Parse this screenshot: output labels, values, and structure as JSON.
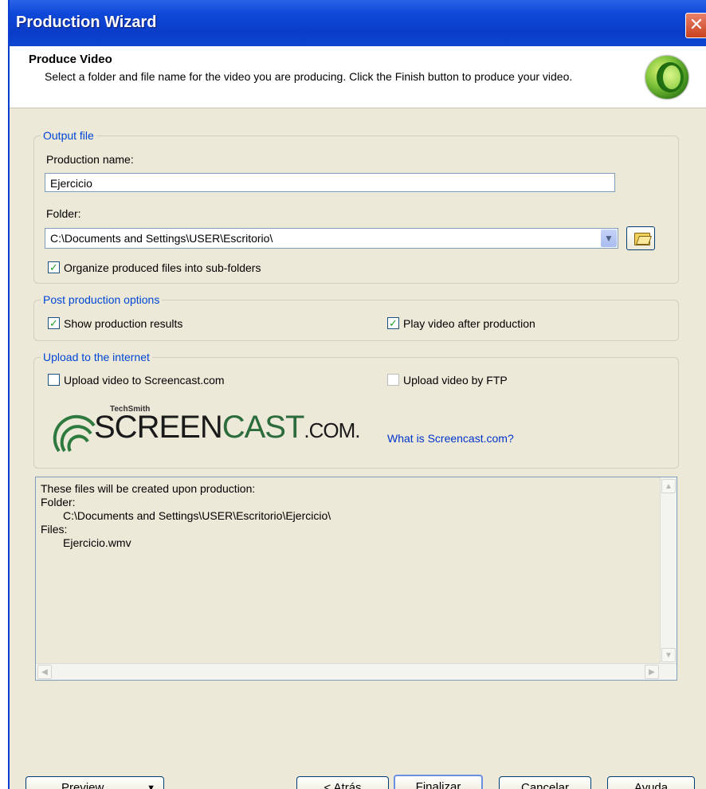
{
  "window": {
    "title": "Production Wizard",
    "close_glyph": "✕"
  },
  "header": {
    "title": "Produce Video",
    "description": "Select a folder and file name for the video you are producing.  Click the Finish button to produce your video."
  },
  "output_file": {
    "legend": "Output file",
    "production_name_label": "Production name:",
    "production_name_value": "Ejercicio",
    "folder_label": "Folder:",
    "folder_value": "C:\\Documents and Settings\\USER\\Escritorio\\",
    "organize_label": "Organize produced files into sub-folders",
    "organize_checked": true
  },
  "post_production": {
    "legend": "Post production options",
    "show_results_label": "Show production results",
    "show_results_checked": true,
    "play_video_label": "Play video after production",
    "play_video_checked": true
  },
  "upload": {
    "legend": "Upload to the internet",
    "screencast_label": "Upload video to Screencast.com",
    "screencast_checked": false,
    "ftp_label": "Upload video by FTP",
    "ftp_checked": false,
    "logo_techsmith": "TechSmith",
    "logo_word1": "SCREEN",
    "logo_word2": "CAST",
    "logo_word3": ".COM.",
    "link_text": "What is Screencast.com?"
  },
  "summary": {
    "lines": [
      "These files will be created upon production:",
      "Folder:",
      "C:\\Documents and Settings\\USER\\Escritorio\\Ejercicio\\",
      "Files:",
      "Ejercicio.wmv"
    ]
  },
  "buttons": {
    "preview": "Preview",
    "back": "< Atrás",
    "finish": "Finalizar",
    "cancel": "Cancelar",
    "help": "Ayuda"
  }
}
